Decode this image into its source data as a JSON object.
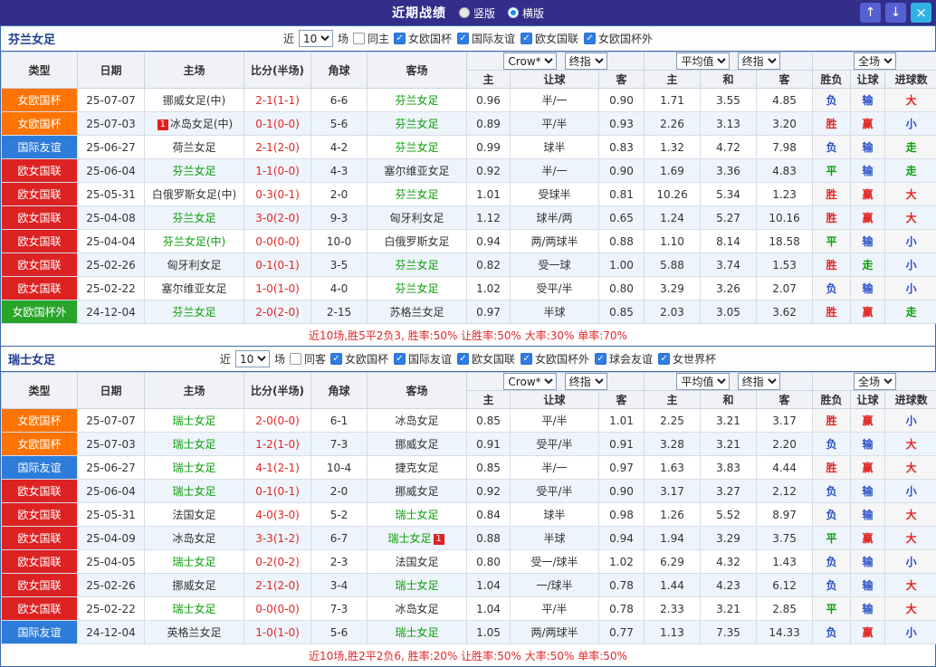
{
  "topbar": {
    "title": "近期战绩",
    "vertical_label": "竖版",
    "horizontal_label": "横版",
    "up_icon": "↑",
    "down_icon": "↓",
    "close_icon": "×"
  },
  "icons": {
    "check": "✓"
  },
  "colors": {
    "type": {
      "女欧国杯": "#ff7300",
      "国际友谊": "#2e7cd9",
      "欧女国联": "#dd2222",
      "女欧国杯外": "#28a428"
    },
    "result": {
      "win": "#e32525",
      "draw": "#0a9e0a",
      "lose": "#2b50c8"
    }
  },
  "table_header": {
    "type": "类型",
    "date": "日期",
    "home": "主场",
    "score": "比分(半场)",
    "corner": "角球",
    "away": "客场",
    "group1": {
      "select1": "Crow*",
      "select2": "终指",
      "cols": [
        "主",
        "让球",
        "客"
      ]
    },
    "group2": {
      "select1": "平均值",
      "select2": "终指",
      "cols": [
        "主",
        "和",
        "客"
      ]
    },
    "group3": {
      "select1": "全场",
      "cols": [
        "胜负",
        "让球",
        "进球数"
      ]
    }
  },
  "sections": [
    {
      "team": "芬兰女足",
      "filter": {
        "near": "近",
        "count": "10",
        "unit": "场",
        "same": "同主",
        "leagues": [
          "女欧国杯",
          "国际友谊",
          "欧女国联",
          "女欧国杯外"
        ]
      },
      "rows": [
        {
          "type": "女欧国杯",
          "date": "25-07-07",
          "home": "挪威女足(中)",
          "score": "2-1(1-1)",
          "corner": "6-6",
          "away": "芬兰女足",
          "away_green": true,
          "o1": "0.96",
          "line": "半/一",
          "o2": "0.90",
          "a1": "1.71",
          "a2": "3.55",
          "a3": "4.85",
          "r1": "负",
          "r2": "输",
          "r3": "大"
        },
        {
          "type": "女欧国杯",
          "date": "25-07-03",
          "home": "冰岛女足(中)",
          "home_badge": "1",
          "score": "0-1(0-0)",
          "corner": "5-6",
          "away": "芬兰女足",
          "away_green": true,
          "o1": "0.89",
          "line": "平/半",
          "o2": "0.93",
          "a1": "2.26",
          "a2": "3.13",
          "a3": "3.20",
          "r1": "胜",
          "r2": "赢",
          "r3": "小"
        },
        {
          "type": "国际友谊",
          "date": "25-06-27",
          "home": "荷兰女足",
          "score": "2-1(2-0)",
          "corner": "4-2",
          "away": "芬兰女足",
          "away_green": true,
          "o1": "0.99",
          "line": "球半",
          "o2": "0.83",
          "a1": "1.32",
          "a2": "4.72",
          "a3": "7.98",
          "r1": "负",
          "r2": "输",
          "r3": "走"
        },
        {
          "type": "欧女国联",
          "date": "25-06-04",
          "home": "芬兰女足",
          "home_green": true,
          "score": "1-1(0-0)",
          "corner": "4-3",
          "away": "塞尔维亚女足",
          "o1": "0.92",
          "line": "半/一",
          "o2": "0.90",
          "a1": "1.69",
          "a2": "3.36",
          "a3": "4.83",
          "r1": "平",
          "r2": "输",
          "r3": "走"
        },
        {
          "type": "欧女国联",
          "date": "25-05-31",
          "home": "白俄罗斯女足(中)",
          "score": "0-3(0-1)",
          "corner": "2-0",
          "away": "芬兰女足",
          "away_green": true,
          "o1": "1.01",
          "line": "受球半",
          "o2": "0.81",
          "a1": "10.26",
          "a2": "5.34",
          "a3": "1.23",
          "r1": "胜",
          "r2": "赢",
          "r3": "大"
        },
        {
          "type": "欧女国联",
          "date": "25-04-08",
          "home": "芬兰女足",
          "home_green": true,
          "score": "3-0(2-0)",
          "corner": "9-3",
          "away": "匈牙利女足",
          "o1": "1.12",
          "line": "球半/两",
          "o2": "0.65",
          "a1": "1.24",
          "a2": "5.27",
          "a3": "10.16",
          "r1": "胜",
          "r2": "赢",
          "r3": "大"
        },
        {
          "type": "欧女国联",
          "date": "25-04-04",
          "home": "芬兰女足(中)",
          "home_green": true,
          "score": "0-0(0-0)",
          "corner": "10-0",
          "away": "白俄罗斯女足",
          "o1": "0.94",
          "line": "两/两球半",
          "o2": "0.88",
          "a1": "1.10",
          "a2": "8.14",
          "a3": "18.58",
          "r1": "平",
          "r2": "输",
          "r3": "小"
        },
        {
          "type": "欧女国联",
          "date": "25-02-26",
          "home": "匈牙利女足",
          "score": "0-1(0-1)",
          "corner": "3-5",
          "away": "芬兰女足",
          "away_green": true,
          "o1": "0.82",
          "line": "受一球",
          "o2": "1.00",
          "a1": "5.88",
          "a2": "3.74",
          "a3": "1.53",
          "r1": "胜",
          "r2": "走",
          "r3": "小"
        },
        {
          "type": "欧女国联",
          "date": "25-02-22",
          "home": "塞尔维亚女足",
          "score": "1-0(1-0)",
          "corner": "4-0",
          "away": "芬兰女足",
          "away_green": true,
          "o1": "1.02",
          "line": "受平/半",
          "o2": "0.80",
          "a1": "3.29",
          "a2": "3.26",
          "a3": "2.07",
          "r1": "负",
          "r2": "输",
          "r3": "小"
        },
        {
          "type": "女欧国杯外",
          "date": "24-12-04",
          "home": "芬兰女足",
          "home_green": true,
          "score": "2-0(2-0)",
          "corner": "2-15",
          "away": "苏格兰女足",
          "o1": "0.97",
          "line": "半球",
          "o2": "0.85",
          "a1": "2.03",
          "a2": "3.05",
          "a3": "3.62",
          "r1": "胜",
          "r2": "赢",
          "r3": "走"
        }
      ],
      "summary": "近10场,胜5平2负3, 胜率:50% 让胜率:50% 大率:30% 单率:70%"
    },
    {
      "team": "瑞士女足",
      "filter": {
        "near": "近",
        "count": "10",
        "unit": "场",
        "same": "同客",
        "leagues": [
          "女欧国杯",
          "国际友谊",
          "欧女国联",
          "女欧国杯外",
          "球会友谊",
          "女世界杯"
        ]
      },
      "rows": [
        {
          "type": "女欧国杯",
          "date": "25-07-07",
          "home": "瑞士女足",
          "home_green": true,
          "score": "2-0(0-0)",
          "corner": "6-1",
          "away": "冰岛女足",
          "o1": "0.85",
          "line": "平/半",
          "o2": "1.01",
          "a1": "2.25",
          "a2": "3.21",
          "a3": "3.17",
          "r1": "胜",
          "r2": "赢",
          "r3": "小"
        },
        {
          "type": "女欧国杯",
          "date": "25-07-03",
          "home": "瑞士女足",
          "home_green": true,
          "score": "1-2(1-0)",
          "corner": "7-3",
          "away": "挪威女足",
          "o1": "0.91",
          "line": "受平/半",
          "o2": "0.91",
          "a1": "3.28",
          "a2": "3.21",
          "a3": "2.20",
          "r1": "负",
          "r2": "输",
          "r3": "大"
        },
        {
          "type": "国际友谊",
          "date": "25-06-27",
          "home": "瑞士女足",
          "home_green": true,
          "score": "4-1(2-1)",
          "corner": "10-4",
          "away": "捷克女足",
          "o1": "0.85",
          "line": "半/一",
          "o2": "0.97",
          "a1": "1.63",
          "a2": "3.83",
          "a3": "4.44",
          "r1": "胜",
          "r2": "赢",
          "r3": "大"
        },
        {
          "type": "欧女国联",
          "date": "25-06-04",
          "home": "瑞士女足",
          "home_green": true,
          "score": "0-1(0-1)",
          "corner": "2-0",
          "away": "挪威女足",
          "o1": "0.92",
          "line": "受平/半",
          "o2": "0.90",
          "a1": "3.17",
          "a2": "3.27",
          "a3": "2.12",
          "r1": "负",
          "r2": "输",
          "r3": "小"
        },
        {
          "type": "欧女国联",
          "date": "25-05-31",
          "home": "法国女足",
          "score": "4-0(3-0)",
          "corner": "5-2",
          "away": "瑞士女足",
          "away_green": true,
          "o1": "0.84",
          "line": "球半",
          "o2": "0.98",
          "a1": "1.26",
          "a2": "5.52",
          "a3": "8.97",
          "r1": "负",
          "r2": "输",
          "r3": "大"
        },
        {
          "type": "欧女国联",
          "date": "25-04-09",
          "home": "冰岛女足",
          "score": "3-3(1-2)",
          "corner": "6-7",
          "away": "瑞士女足",
          "away_green": true,
          "away_badge": "1",
          "o1": "0.88",
          "line": "半球",
          "o2": "0.94",
          "a1": "1.94",
          "a2": "3.29",
          "a3": "3.75",
          "r1": "平",
          "r2": "赢",
          "r3": "大"
        },
        {
          "type": "欧女国联",
          "date": "25-04-05",
          "home": "瑞士女足",
          "home_green": true,
          "score": "0-2(0-2)",
          "corner": "2-3",
          "away": "法国女足",
          "o1": "0.80",
          "line": "受一/球半",
          "o2": "1.02",
          "a1": "6.29",
          "a2": "4.32",
          "a3": "1.43",
          "r1": "负",
          "r2": "输",
          "r3": "小"
        },
        {
          "type": "欧女国联",
          "date": "25-02-26",
          "home": "挪威女足",
          "score": "2-1(2-0)",
          "corner": "3-4",
          "away": "瑞士女足",
          "away_green": true,
          "o1": "1.04",
          "line": "一/球半",
          "o2": "0.78",
          "a1": "1.44",
          "a2": "4.23",
          "a3": "6.12",
          "r1": "负",
          "r2": "输",
          "r3": "大"
        },
        {
          "type": "欧女国联",
          "date": "25-02-22",
          "home": "瑞士女足",
          "home_green": true,
          "score": "0-0(0-0)",
          "corner": "7-3",
          "away": "冰岛女足",
          "o1": "1.04",
          "line": "平/半",
          "o2": "0.78",
          "a1": "2.33",
          "a2": "3.21",
          "a3": "2.85",
          "r1": "平",
          "r2": "输",
          "r3": "大"
        },
        {
          "type": "国际友谊",
          "date": "24-12-04",
          "home": "英格兰女足",
          "score": "1-0(1-0)",
          "corner": "5-6",
          "away": "瑞士女足",
          "away_green": true,
          "o1": "1.05",
          "line": "两/两球半",
          "o2": "0.77",
          "a1": "1.13",
          "a2": "7.35",
          "a3": "14.33",
          "r1": "负",
          "r2": "赢",
          "r3": "小"
        }
      ],
      "summary": "近10场,胜2平2负6, 胜率:20% 让胜率:50% 大率:50% 单率:50%"
    }
  ]
}
